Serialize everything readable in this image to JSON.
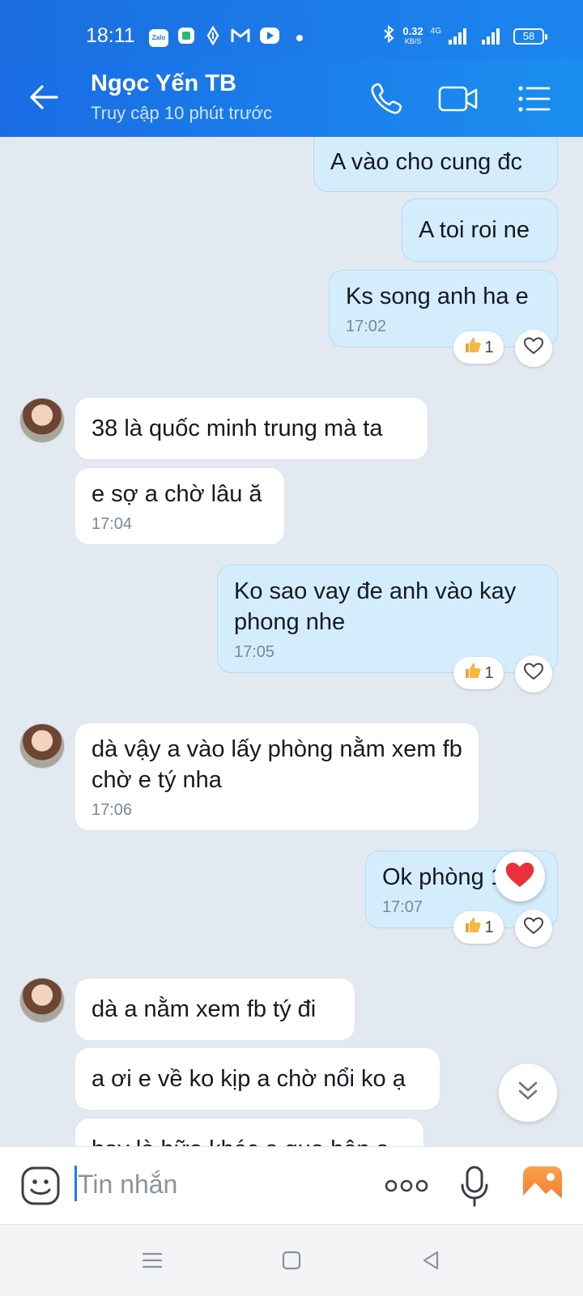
{
  "status_bar": {
    "time": "18:11",
    "app_zalo_label": "Zalo",
    "net_speed": "0.32",
    "net_unit": "KB/S",
    "network_type": "4G",
    "battery": "58"
  },
  "header": {
    "title": "Ngọc Yến TB",
    "subtitle": "Truy cập 10 phút trước"
  },
  "messages": {
    "m1": {
      "text": "A vào cho cung đc"
    },
    "m2": {
      "text": "A toi roi ne"
    },
    "m3": {
      "text": "Ks song anh ha e",
      "time": "17:02",
      "reaction_count": "1"
    },
    "m4": {
      "text": "38 là quốc minh trung mà ta"
    },
    "m5": {
      "text": "e sợ a chờ lâu ă",
      "time": "17:04"
    },
    "m6": {
      "text": "Ko sao vay đe anh vào kay phong nhe",
      "time": "17:05",
      "reaction_count": "1"
    },
    "m7": {
      "text": "dà vậy a vào lấy phòng nằm xem fb chờ e tý nha",
      "time": "17:06"
    },
    "m8": {
      "text": "Ok phòng 112",
      "time": "17:07",
      "reaction_count": "1"
    },
    "m9": {
      "text": "dà a nằm xem fb tý đi"
    },
    "m10": {
      "text": "a ơi e về ko kịp a chờ nổi ko ạ"
    },
    "m11": {
      "text": "hay là hữa khác a qua hôn a"
    }
  },
  "composer": {
    "placeholder": "Tin nhắn"
  },
  "colors": {
    "header_blue": "#1b7ce8",
    "outgoing_bubble": "#d4edfd",
    "incoming_bubble": "#ffffff",
    "chat_background": "#e2e9f1",
    "image_icon_orange": "#f5883a"
  }
}
